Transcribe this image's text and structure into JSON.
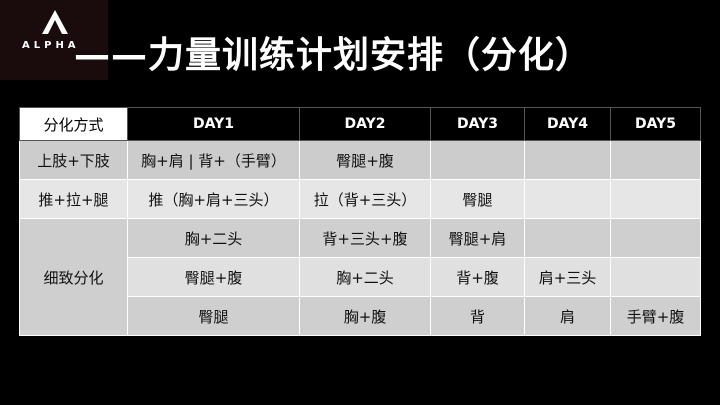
{
  "logo": {
    "text": "ALPHA"
  },
  "title": "——力量训练计划安排（分化）",
  "table": {
    "headers": [
      "分化方式",
      "DAY1",
      "DAY2",
      "DAY3",
      "DAY4",
      "DAY5"
    ],
    "rows": [
      {
        "type": "上肢+下肢",
        "cells": [
          "胸+肩 | 背+（手臂）",
          "臀腿+腹",
          "",
          "",
          ""
        ]
      },
      {
        "type": "推+拉+腿",
        "cells": [
          "推（胸+肩+三头）",
          "拉（背+三头）",
          "臀腿",
          "",
          ""
        ]
      }
    ],
    "group": {
      "type": "细致分化",
      "rows": [
        [
          "胸+二头",
          "背+三头+腹",
          "臀腿+肩",
          "",
          ""
        ],
        [
          "臀腿+腹",
          "胸+二头",
          "背+腹",
          "肩+三头",
          ""
        ],
        [
          "臀腿",
          "胸+腹",
          "背",
          "肩",
          "手臂+腹"
        ]
      ]
    }
  }
}
